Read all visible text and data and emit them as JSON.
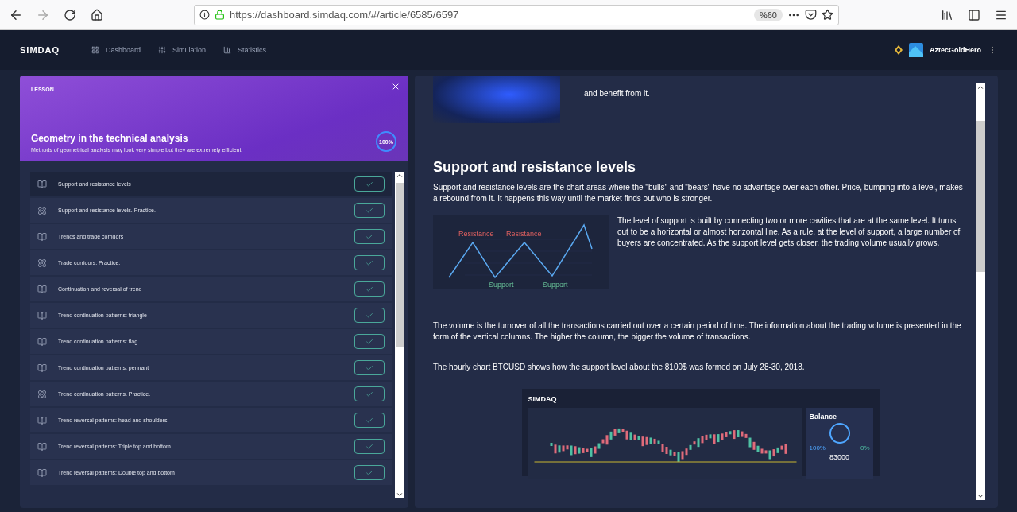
{
  "browser": {
    "url": "https://dashboard.simdaq.com/#/article/6585/6597",
    "zoom": "%60"
  },
  "header": {
    "logo": "SIMDAQ",
    "nav": [
      {
        "label": "Dashboard",
        "selected": false
      },
      {
        "label": "Simulation",
        "selected": false
      },
      {
        "label": "Statistics",
        "selected": false
      }
    ],
    "user": "AztecGoldHero"
  },
  "lesson": {
    "tag": "LESSON",
    "title": "Geometry in the technical analysis",
    "subtitle": "Methods of geometrical analysis may look very simple but they are extremely efficient.",
    "progress": {
      "label": "100%",
      "level": 1
    },
    "items": [
      {
        "kind": "lesson",
        "label": "Support and resistance levels",
        "selected": true,
        "done": true
      },
      {
        "kind": "practice",
        "label": "Support and resistance levels. Practice.",
        "selected": false,
        "done": true
      },
      {
        "kind": "lesson",
        "label": "Trends and trade corridors",
        "selected": false,
        "done": true
      },
      {
        "kind": "practice",
        "label": "Trade corridors. Practice.",
        "selected": false,
        "done": true
      },
      {
        "kind": "lesson",
        "label": "Continuation and reversal of trend",
        "selected": false,
        "done": true
      },
      {
        "kind": "lesson",
        "label": "Trend continuation patterns: triangle",
        "selected": false,
        "done": true
      },
      {
        "kind": "lesson",
        "label": "Trend continuation patterns: flag",
        "selected": false,
        "done": true
      },
      {
        "kind": "lesson",
        "label": "Trend continuation patterns: pennant",
        "selected": false,
        "done": true
      },
      {
        "kind": "practice",
        "label": "Trend continuation patterns. Practice.",
        "selected": false,
        "done": true
      },
      {
        "kind": "lesson",
        "label": "Trend reversal patterns: head and shoulders",
        "selected": false,
        "done": true
      },
      {
        "kind": "lesson",
        "label": "Trend reversal patterns: Triple top and bottom",
        "selected": false,
        "done": true
      },
      {
        "kind": "lesson",
        "label": "Trend reversal patterns: Double top and bottom",
        "selected": false,
        "done": true
      }
    ]
  },
  "article": {
    "intro_tail": "and benefit from it.",
    "heading": "Support and resistance levels",
    "para1": "Support and resistance levels are the chart areas where the \"bulls\" and \"bears\" have no advantage over each other. Price, bumping into a level, makes a rebound from it. It happens this way until the market finds out who is stronger.",
    "diagram": {
      "resistance": [
        "Resistance",
        "Resistance"
      ],
      "support": [
        "Support",
        "Support"
      ]
    },
    "para2": "The level of support is built by connecting two or more cavities that are at the same level. It turns out to be a horizontal or almost horizontal line. As a rule, at the level of support, a large number of buyers are concentrated. As the support level gets closer, the trading volume usually grows.",
    "para3": "The volume is the turnover of all the transactions carried out over a certain period of time. The information about the trading volume is presented in the form of the vertical columns. The higher the column, the bigger the volume of transactions.",
    "para4": "The hourly chart BTCUSD shows how the support level about the 8100$ was formed on July 28-30, 2018.",
    "shot": {
      "logo": "SIMDAQ",
      "balance": "Balance",
      "cash": "100%",
      "shares": "0%",
      "amount": "83000"
    }
  }
}
